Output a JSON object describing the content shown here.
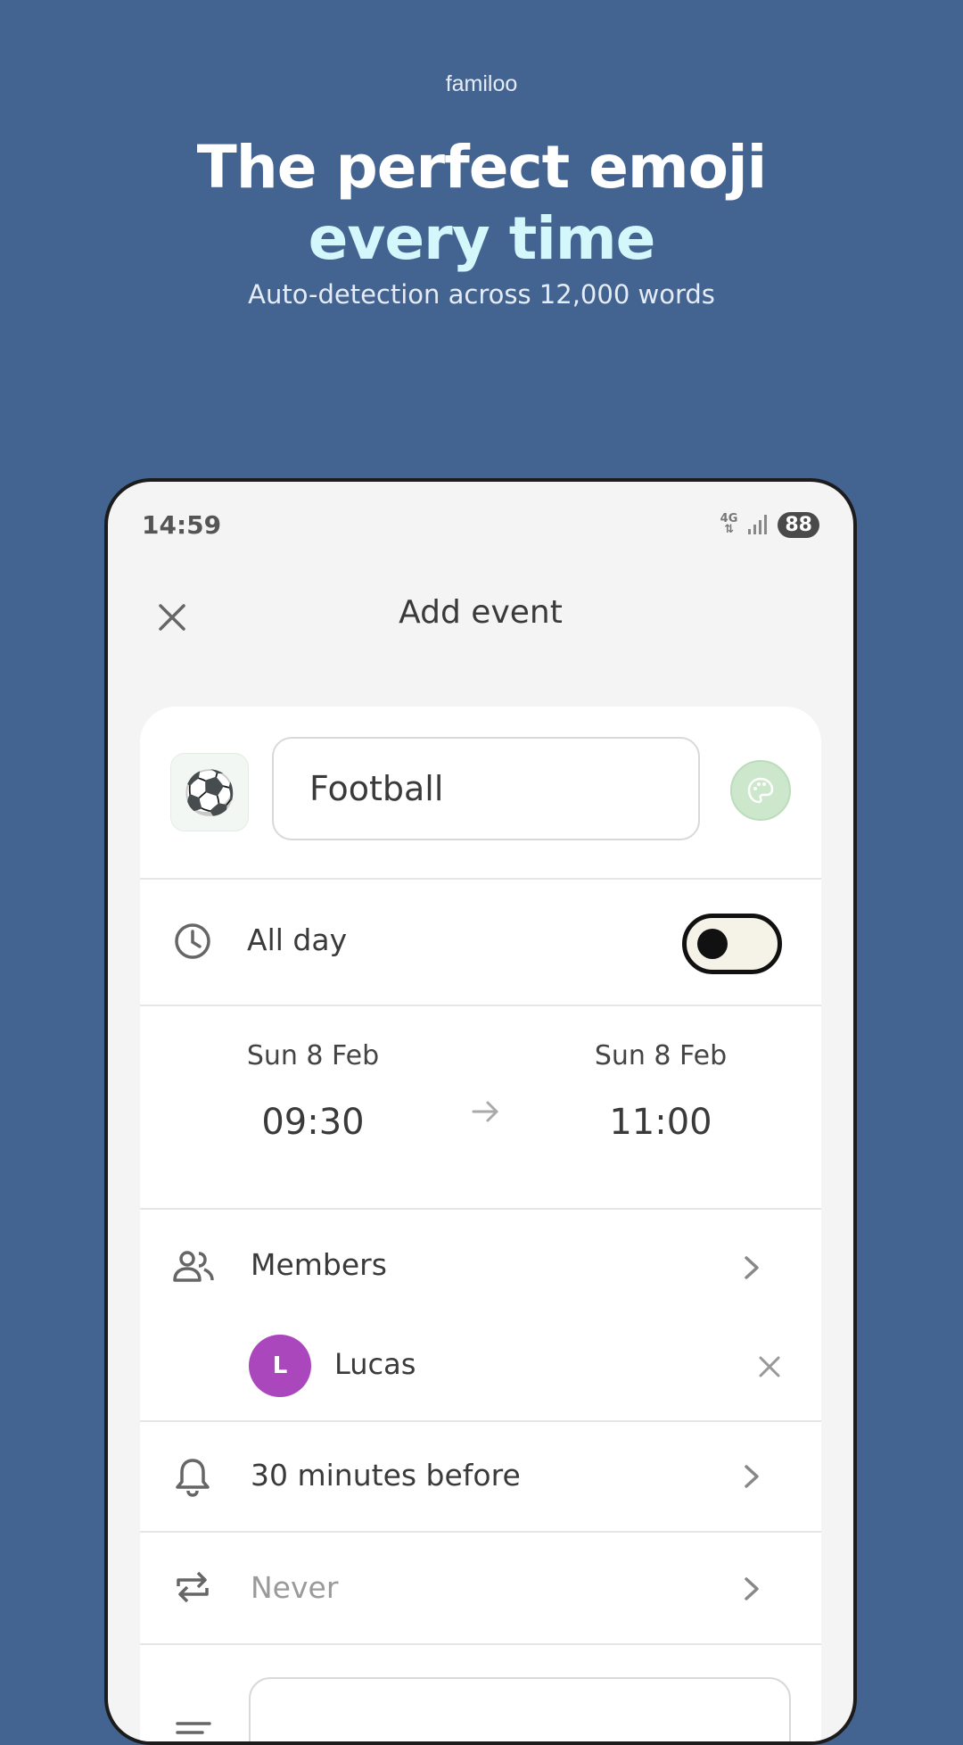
{
  "promo": {
    "brand": "familoo",
    "headline_line1": "The perfect emoji",
    "headline_line2": "every time",
    "subheadline": "Auto-detection across 12,000 words"
  },
  "status_bar": {
    "time": "14:59",
    "network": "4G",
    "battery": "88"
  },
  "screen": {
    "title": "Add event",
    "close_icon": "close-icon"
  },
  "event": {
    "emoji": "⚽",
    "name": "Football",
    "palette_icon": "palette-icon"
  },
  "all_day": {
    "label": "All day",
    "enabled": false
  },
  "dates": {
    "start_date": "Sun 8 Feb",
    "start_time": "09:30",
    "end_date": "Sun 8 Feb",
    "end_time": "11:00"
  },
  "members": {
    "label": "Members",
    "list": [
      {
        "initial": "L",
        "name": "Lucas",
        "color": "#ab47bc"
      }
    ]
  },
  "reminder": {
    "label": "30 minutes before"
  },
  "repeat": {
    "label": "Never"
  },
  "colors": {
    "background": "#436491",
    "headline_accent": "#d4f7fb",
    "avatar": "#ab47bc",
    "palette_button": "#cce7cc"
  }
}
